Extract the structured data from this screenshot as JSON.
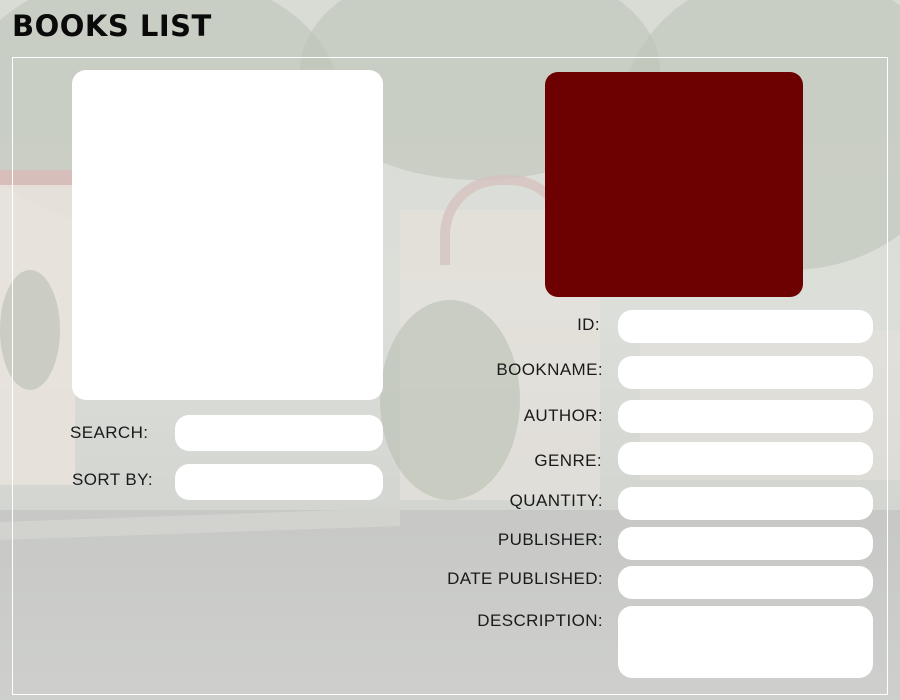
{
  "header": {
    "title": "BOOKS LIST"
  },
  "left": {
    "search_label": "SEARCH:",
    "sort_label": "SORT BY:",
    "search_value": "",
    "sort_value": ""
  },
  "details": {
    "cover_color": "#6d0101",
    "fields": {
      "id": {
        "label": "ID:",
        "value": ""
      },
      "bookname": {
        "label": "BOOKNAME:",
        "value": ""
      },
      "author": {
        "label": "AUTHOR:",
        "value": ""
      },
      "genre": {
        "label": "GENRE:",
        "value": ""
      },
      "quantity": {
        "label": "QUANTITY:",
        "value": ""
      },
      "publisher": {
        "label": "PUBLISHER:",
        "value": ""
      },
      "date_published": {
        "label": "DATE PUBLISHED:",
        "value": ""
      },
      "description": {
        "label": "DESCRIPTION:",
        "value": ""
      }
    }
  }
}
